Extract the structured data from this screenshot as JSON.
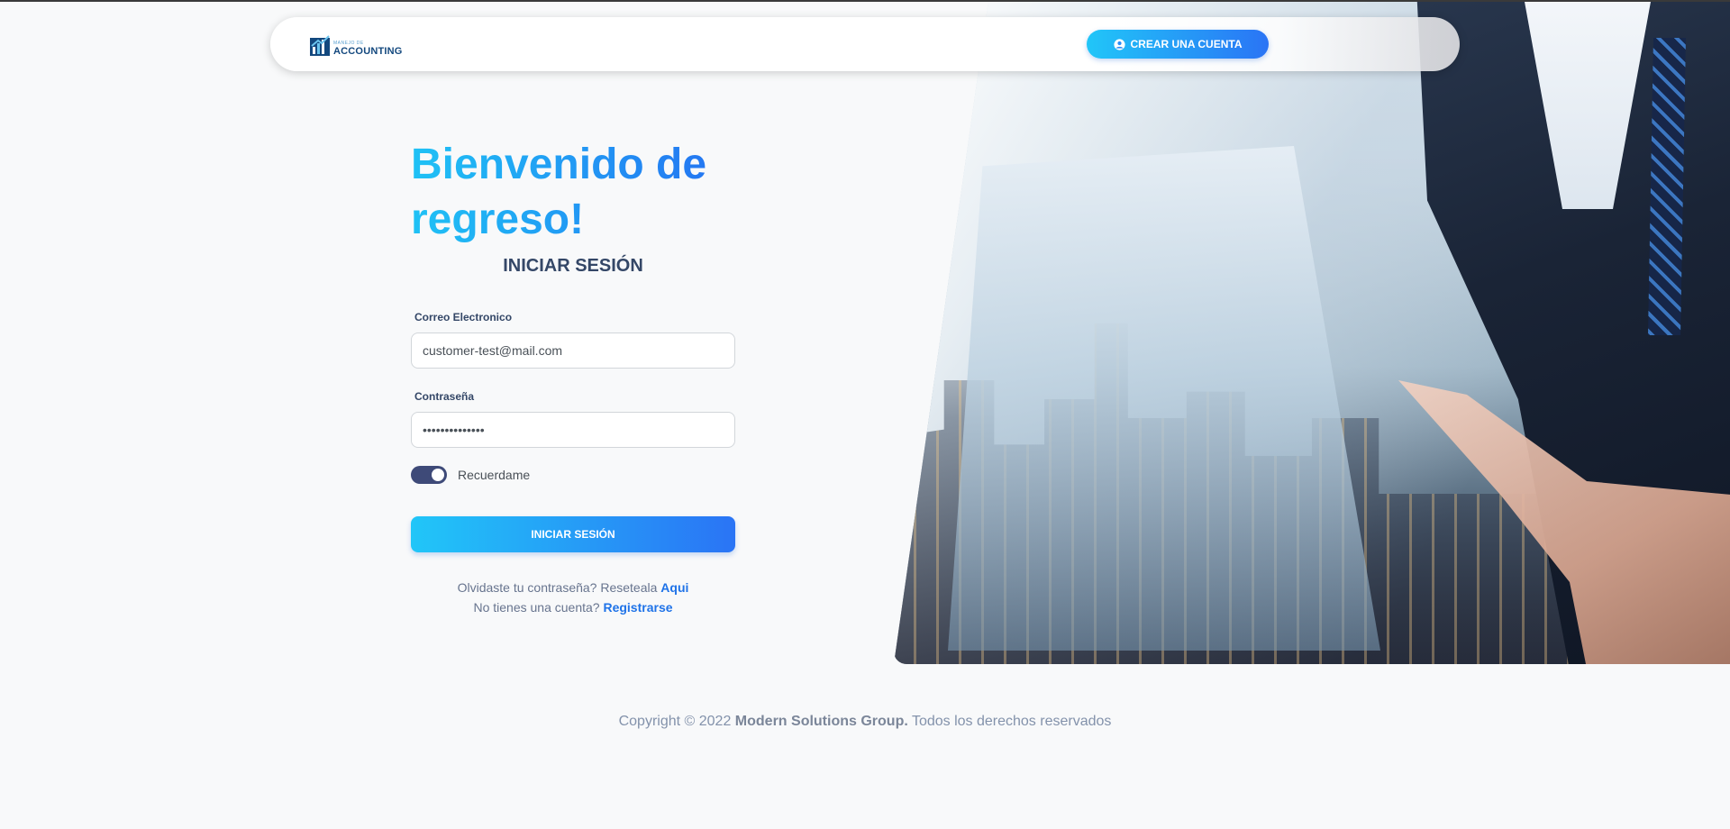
{
  "colors": {
    "accent_start": "#21c6f8",
    "accent_end": "#2a74f5",
    "heading": "#344767",
    "link": "#1f73e8",
    "toggle_on": "#3e4a78"
  },
  "navbar": {
    "logo_small_text": "MANEJO DE",
    "logo_main_text": "ACCOUNTING",
    "logo_icon": "chart-building-icon",
    "create_account_label": "CREAR UNA CUENTA",
    "create_account_icon": "user-circle-icon"
  },
  "login": {
    "welcome_title": "Bienvenido de regreso!",
    "subtitle": "INICIAR SESIÓN",
    "email_label": "Correo Electronico",
    "email_value": "customer-test@mail.com",
    "password_label": "Contraseña",
    "password_value": "••••••••••••••",
    "remember_label": "Recuerdame",
    "remember_checked": true,
    "submit_label": "INICIAR SESIÓN",
    "forgot_text": "Olvidaste tu contraseña? Reseteala",
    "forgot_link": "Aqui",
    "no_account_text": "No tienes una cuenta?",
    "register_link": "Registrarse"
  },
  "footer": {
    "prefix": "Copyright © 2022",
    "company": "Modern Solutions Group.",
    "suffix": "Todos los derechos reservados"
  }
}
